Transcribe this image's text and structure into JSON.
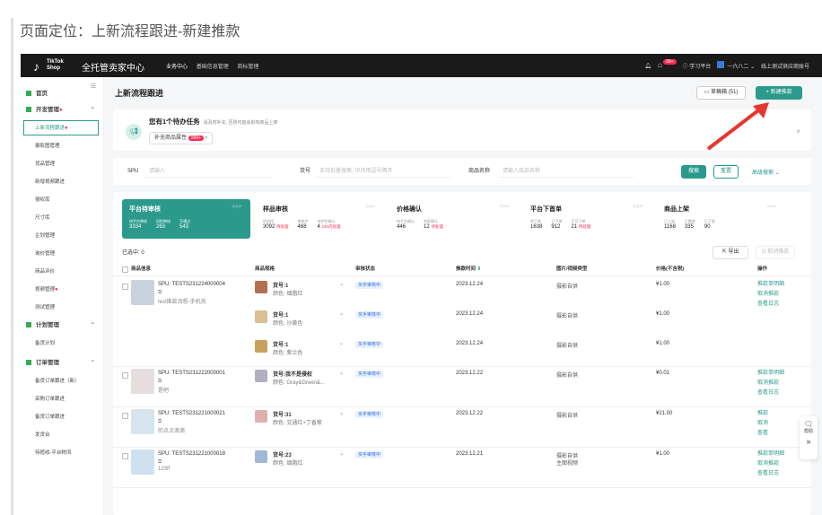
{
  "doc": {
    "title": "页面定位：上新流程跟进-新建推款"
  },
  "topbar": {
    "logo_mark": "♪",
    "logo_text1": "TikTok",
    "logo_text2": "Shop",
    "app_title": "全托管卖家中心",
    "nav": [
      "业务中心",
      "基础信息管理",
      "商标管理"
    ],
    "notif_badge": "99+",
    "study": "学习平台",
    "store": "一六八二",
    "account": "线上测试供应商账号"
  },
  "sidebar": {
    "items": [
      {
        "label": "首页",
        "type": "group"
      },
      {
        "label": "开发管理",
        "type": "group",
        "dot": true
      },
      {
        "label": "上新流程跟进",
        "type": "active",
        "dot": true
      },
      {
        "label": "摄影图管理"
      },
      {
        "label": "货品管理"
      },
      {
        "label": "新增视频跟进"
      },
      {
        "label": "侵权库"
      },
      {
        "label": "尺寸库"
      },
      {
        "label": "企划管理"
      },
      {
        "label": "询价管理"
      },
      {
        "label": "商品评价"
      },
      {
        "label": "视频管理",
        "dot": true
      },
      {
        "label": "测试管理"
      },
      {
        "label": "计划管理",
        "type": "group"
      },
      {
        "label": "备货计划"
      },
      {
        "label": "订单管理",
        "type": "group"
      },
      {
        "label": "备货订单跟进（新）"
      },
      {
        "label": "采购订单跟进"
      },
      {
        "label": "备货订单跟进"
      },
      {
        "label": "发货台"
      },
      {
        "label": "待揽收-平台物流"
      }
    ]
  },
  "main": {
    "title": "上新流程跟进",
    "draft_btn": "草稿箱 (51)",
    "new_btn": "+ 新建推款",
    "task": {
      "title": "您有1个待办任务",
      "subtitle": "请及时补充, 否则可能会影响商品上架",
      "chip_label": "补充商品属性",
      "chip_badge": "999+"
    },
    "filters": {
      "spu_label": "SPU",
      "spu_placeholder": "请输入",
      "item_label": "货号",
      "item_placeholder": "支持批量搜索, 中间用逗号隔开",
      "name_label": "商品名称",
      "name_placeholder": "请输入商品名称",
      "search": "搜索",
      "reset": "重置",
      "advanced": "高级搜索"
    },
    "stats": [
      {
        "title": "平台待审核",
        "cols": [
          {
            "l": "待平台审核",
            "v": "3334"
          },
          {
            "l": "风险审核",
            "v": "263"
          },
          {
            "l": "不通过",
            "v": "543"
          }
        ]
      },
      {
        "title": "样品审核",
        "cols": [
          {
            "l": "待送样",
            "v": "3092",
            "e": "待处理"
          },
          {
            "l": "审核中",
            "v": "468"
          },
          {
            "l": "待供货确认",
            "v": "4",
            "e": "24h内处理"
          }
        ]
      },
      {
        "title": "价格确认",
        "cols": [
          {
            "l": "待平台确认",
            "v": "446"
          },
          {
            "l": "商家确认",
            "v": "12",
            "e": "待处理"
          }
        ]
      },
      {
        "title": "平台下首单",
        "cols": [
          {
            "l": "待下单",
            "v": "1638"
          },
          {
            "l": "已下单",
            "v": "912"
          },
          {
            "l": "不可下单",
            "v": "21",
            "e": "待处理"
          }
        ]
      },
      {
        "title": "商品上架",
        "cols": [
          {
            "l": "已上架",
            "v": "1168"
          },
          {
            "l": "已删除",
            "v": "335"
          },
          {
            "l": "已下架",
            "v": "90"
          }
        ]
      }
    ],
    "selected": "已选中: 0",
    "export": "导出",
    "cancel_push": "取消推款",
    "columns": [
      "商品信息",
      "商品规格",
      "审核状态",
      "推款时间",
      "图片/视频类型",
      "价格(不含税)",
      "操作"
    ],
    "rows": [
      {
        "spu": "SPU: TESTS231224000004",
        "desc": "test推款流程-手机壳",
        "specs": [
          {
            "item": "货号:1",
            "color": "颜色: 烟脂红",
            "status": "买手审核中",
            "time": "2023.12.24",
            "img": "摄影自供",
            "price": "¥1.00"
          },
          {
            "item": "货号:1",
            "color": "颜色: 沙黄色",
            "status": "买手审核中",
            "time": "2023.12.24",
            "img": "摄影自供",
            "price": "¥1.00"
          },
          {
            "item": "货号:1",
            "color": "颜色: 紫兰色",
            "status": "买手审核中",
            "time": "2023.12.24",
            "img": "摄影自供",
            "price": "¥1.00"
          }
        ],
        "ops": [
          "推款单明细",
          "取消推款",
          "查看日志"
        ]
      },
      {
        "spu": "SPU: TESTS231222000001",
        "desc": "是吧",
        "specs": [
          {
            "item": "货号:我不是侵权",
            "color": "颜色: Gray&Green&...",
            "status": "买手审核中",
            "time": "2023.12.22",
            "img": "摄影自供",
            "price": "¥0.01"
          }
        ],
        "ops": [
          "推款单明细",
          "取消推款",
          "查看日志"
        ]
      },
      {
        "spu": "SPU: TESTS231221000021",
        "desc": "的点点滴滴",
        "specs": [
          {
            "item": "货号:31",
            "color": "颜色: 交通红+丁香紫",
            "status": "买手审核中",
            "time": "2023.12.22",
            "img": "摄影自供",
            "price": "¥21.00"
          }
        ],
        "ops": [
          "推款",
          "取消",
          "查看"
        ]
      },
      {
        "spu": "SPU: TESTS231221000018",
        "desc": "123ff",
        "specs": [
          {
            "item": "货号:23",
            "color": "颜色: 烟脂红",
            "status": "买手审核中",
            "time": "2023.12.21",
            "img": "摄影自供",
            "img2": "主图视频",
            "price": "¥1.00"
          }
        ],
        "ops": [
          "推款单明细",
          "取消推款",
          "查看日志"
        ]
      }
    ],
    "float": {
      "help": "帮助"
    }
  }
}
